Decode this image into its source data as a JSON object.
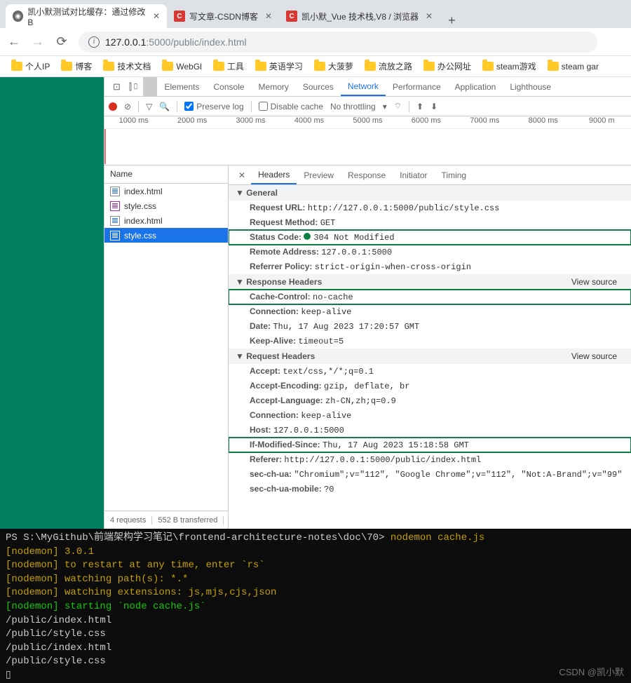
{
  "browser_tabs": [
    {
      "title": "凯小默测试对比缓存：通过修改B",
      "fav": "globe"
    },
    {
      "title": "写文章-CSDN博客",
      "fav": "C"
    },
    {
      "title": "凯小默_Vue 技术栈,V8 / 浏览器",
      "fav": "C"
    }
  ],
  "address": {
    "host": "127.0.0.1",
    "port": ":5000",
    "path": "/public/index.html"
  },
  "bookmarks": [
    "个人IP",
    "博客",
    "技术文档",
    "WebGl",
    "工具",
    "英语学习",
    "大菠萝",
    "流放之路",
    "办公网址",
    "steam游戏",
    "steam gar"
  ],
  "devtools_tabs": [
    "Elements",
    "Console",
    "Memory",
    "Sources",
    "Network",
    "Performance",
    "Application",
    "Lighthouse"
  ],
  "devtools_selected": "Network",
  "toolbar": {
    "preserve": "Preserve log",
    "disable": "Disable cache",
    "throttle": "No throttling"
  },
  "timeline_ticks": [
    "1000 ms",
    "2000 ms",
    "3000 ms",
    "4000 ms",
    "5000 ms",
    "6000 ms",
    "7000 ms",
    "8000 ms",
    "9000 m"
  ],
  "name_header": "Name",
  "requests": [
    {
      "name": "index.html",
      "type": "html"
    },
    {
      "name": "style.css",
      "type": "css"
    },
    {
      "name": "index.html",
      "type": "html"
    },
    {
      "name": "style.css",
      "type": "css"
    }
  ],
  "footer": {
    "count": "4 requests",
    "size": "552 B transferred"
  },
  "detail_tabs": [
    "Headers",
    "Preview",
    "Response",
    "Initiator",
    "Timing"
  ],
  "sections": {
    "general": {
      "title": "General",
      "items": [
        {
          "k": "Request URL:",
          "v": "http://127.0.0.1:5000/public/style.css"
        },
        {
          "k": "Request Method:",
          "v": "GET"
        },
        {
          "k": "Status Code:",
          "v": "304 Not Modified",
          "dot": true,
          "hl": true
        },
        {
          "k": "Remote Address:",
          "v": "127.0.0.1:5000"
        },
        {
          "k": "Referrer Policy:",
          "v": "strict-origin-when-cross-origin"
        }
      ]
    },
    "response": {
      "title": "Response Headers",
      "vs": "View source",
      "items": [
        {
          "k": "Cache-Control:",
          "v": "no-cache",
          "hl": true
        },
        {
          "k": "Connection:",
          "v": "keep-alive"
        },
        {
          "k": "Date:",
          "v": "Thu, 17 Aug 2023 17:20:57 GMT"
        },
        {
          "k": "Keep-Alive:",
          "v": "timeout=5"
        }
      ]
    },
    "request": {
      "title": "Request Headers",
      "vs": "View source",
      "items": [
        {
          "k": "Accept:",
          "v": "text/css,*/*;q=0.1"
        },
        {
          "k": "Accept-Encoding:",
          "v": "gzip, deflate, br"
        },
        {
          "k": "Accept-Language:",
          "v": "zh-CN,zh;q=0.9"
        },
        {
          "k": "Connection:",
          "v": "keep-alive"
        },
        {
          "k": "Host:",
          "v": "127.0.0.1:5000"
        },
        {
          "k": "If-Modified-Since:",
          "v": "Thu, 17 Aug 2023 15:18:58 GMT",
          "hl": true
        },
        {
          "k": "Referer:",
          "v": "http://127.0.0.1:5000/public/index.html"
        },
        {
          "k": "sec-ch-ua:",
          "v": "\"Chromium\";v=\"112\", \"Google Chrome\";v=\"112\", \"Not:A-Brand\";v=\"99\""
        },
        {
          "k": "sec-ch-ua-mobile:",
          "v": "?0"
        }
      ]
    }
  },
  "terminal": {
    "prompt": "PS S:\\MyGithub\\前端架构学习笔记\\frontend-architecture-notes\\doc\\70> ",
    "cmd": "nodemon cache.js",
    "lines": [
      {
        "tag": "[nodemon]",
        "txt": " 3.0.1",
        "c": "ylw"
      },
      {
        "tag": "[nodemon]",
        "txt": " to restart at any time, enter `rs`",
        "c": "ylw"
      },
      {
        "tag": "[nodemon]",
        "txt": " watching path(s): *.*",
        "c": "ylw"
      },
      {
        "tag": "[nodemon]",
        "txt": " watching extensions: js,mjs,cjs,json",
        "c": "ylw"
      },
      {
        "tag": "[nodemon]",
        "txt": " starting `node cache.js`",
        "c": "grn"
      }
    ],
    "out": [
      "/public/index.html",
      "/public/style.css",
      "/public/index.html",
      "/public/style.css"
    ],
    "cursor": "▯"
  },
  "watermark": "CSDN @凯小默"
}
